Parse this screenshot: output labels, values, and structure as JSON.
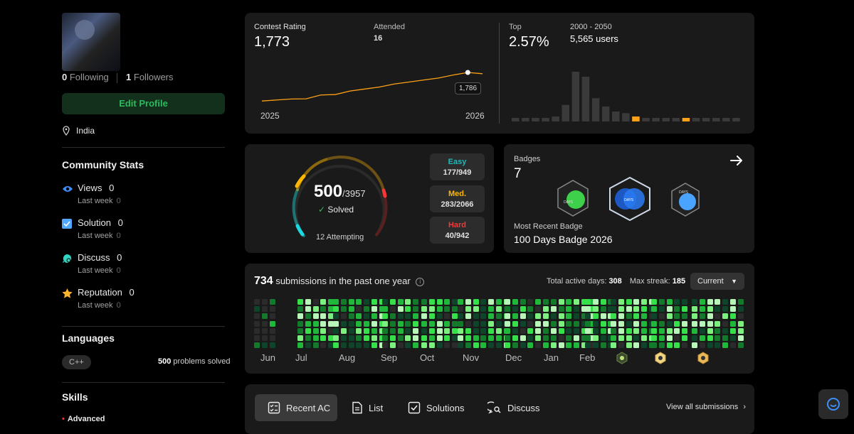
{
  "profile": {
    "following_count": "0",
    "following_label": "Following",
    "followers_count": "1",
    "followers_label": "Followers",
    "edit_label": "Edit Profile",
    "location": "India"
  },
  "community": {
    "title": "Community Stats",
    "items": [
      {
        "label": "Views",
        "value": "0",
        "sub": "Last week",
        "subval": "0",
        "icon": "eye-icon",
        "color": "#3e8ef7"
      },
      {
        "label": "Solution",
        "value": "0",
        "sub": "Last week",
        "subval": "0",
        "icon": "checkbox-icon",
        "color": "#52a8ff"
      },
      {
        "label": "Discuss",
        "value": "0",
        "sub": "Last week",
        "subval": "0",
        "icon": "chat-bubble-icon",
        "color": "#2fd6c3"
      },
      {
        "label": "Reputation",
        "value": "0",
        "sub": "Last week",
        "subval": "0",
        "icon": "star-icon",
        "color": "#ffb326"
      }
    ]
  },
  "languages": {
    "title": "Languages",
    "name": "C++",
    "count": "500",
    "count_suffix": "problems solved"
  },
  "skills": {
    "title": "Skills",
    "level": "Advanced"
  },
  "contest": {
    "rating_label": "Contest Rating",
    "rating": "1,773",
    "attended_label": "Attended",
    "attended": "16",
    "year_start": "2025",
    "year_end": "2026",
    "tooltip_value": "1,786",
    "top_label": "Top",
    "top_value": "2.57%",
    "range_label": "2000 - 2050",
    "users_label": "5,565 users"
  },
  "chart_data": [
    {
      "type": "line",
      "x": [
        "2025",
        "",
        "",
        "",
        "",
        "",
        "",
        "",
        "",
        "",
        "",
        "",
        "",
        "",
        "",
        "2026"
      ],
      "values": [
        1500,
        1510,
        1520,
        1522,
        1560,
        1565,
        1600,
        1620,
        1640,
        1670,
        1690,
        1710,
        1730,
        1760,
        1786,
        1773
      ],
      "color": "#ffa116"
    },
    {
      "type": "bar",
      "values": [
        2,
        2,
        2,
        2,
        3,
        10,
        30,
        27,
        14,
        9,
        6,
        5,
        3,
        2,
        2,
        2,
        2,
        2,
        2,
        2,
        2,
        2,
        2
      ],
      "highlight_indices": [
        12,
        17
      ],
      "color": "#3a3a3a",
      "highlight_color": "#ffa116"
    }
  ],
  "solved": {
    "solved": "500",
    "total": "/3957",
    "solved_label": "Solved",
    "attempting": "12 Attempting",
    "easy_label": "Easy",
    "easy_value": "177/949",
    "med_label": "Med.",
    "med_value": "283/2066",
    "hard_label": "Hard",
    "hard_value": "40/942",
    "colors": {
      "easy": "#1cbaba",
      "med": "#ffb700",
      "hard": "#f63737"
    }
  },
  "badges": {
    "title": "Badges",
    "count": "7",
    "recent_label": "Most Recent Badge",
    "recent_name": "100 Days Badge 2026"
  },
  "submissions": {
    "count": "734",
    "label": "submissions in the past one year",
    "active_label": "Total active days:",
    "active_value": "308",
    "streak_label": "Max streak:",
    "streak_value": "185",
    "dropdown": "Current",
    "months": [
      "Jun",
      "Jul",
      "Aug",
      "Sep",
      "Oct",
      "Nov",
      "Dec",
      "Jan",
      "Feb"
    ]
  },
  "tabs": [
    {
      "label": "Recent AC",
      "icon": "checklist-icon"
    },
    {
      "label": "List",
      "icon": "document-icon"
    },
    {
      "label": "Solutions",
      "icon": "checkbox-icon"
    },
    {
      "label": "Discuss",
      "icon": "chat-search-icon"
    }
  ],
  "view_all": "View all submissions"
}
